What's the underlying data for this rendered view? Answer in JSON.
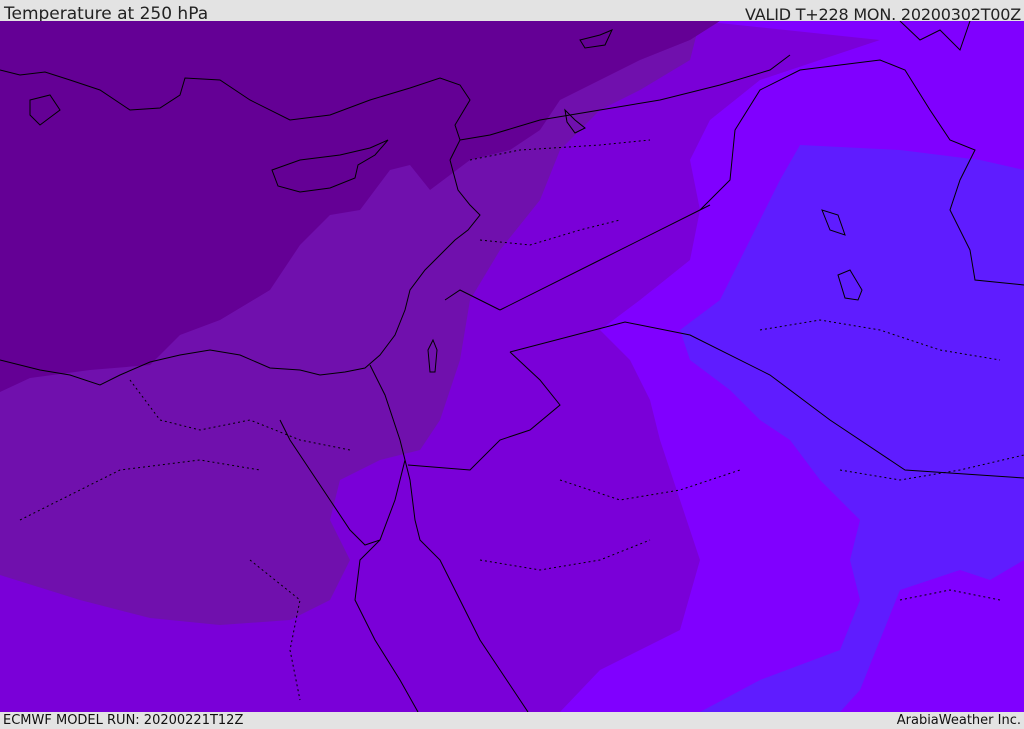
{
  "header": {
    "title": "Temperature at 250 hPa",
    "valid": "VALID T+228 MON. 20200302T00Z"
  },
  "footer": {
    "model_run": "ECMWF MODEL RUN: 20200221T12Z",
    "credit": "ArabiaWeather Inc."
  },
  "map": {
    "field": "temperature-250hpa",
    "colors": {
      "coldest": "#640095",
      "colder": "#7010ad",
      "cold": "#7a00d8",
      "mid": "#8000ff",
      "warm": "#5f1cff",
      "line": "#000000"
    }
  }
}
